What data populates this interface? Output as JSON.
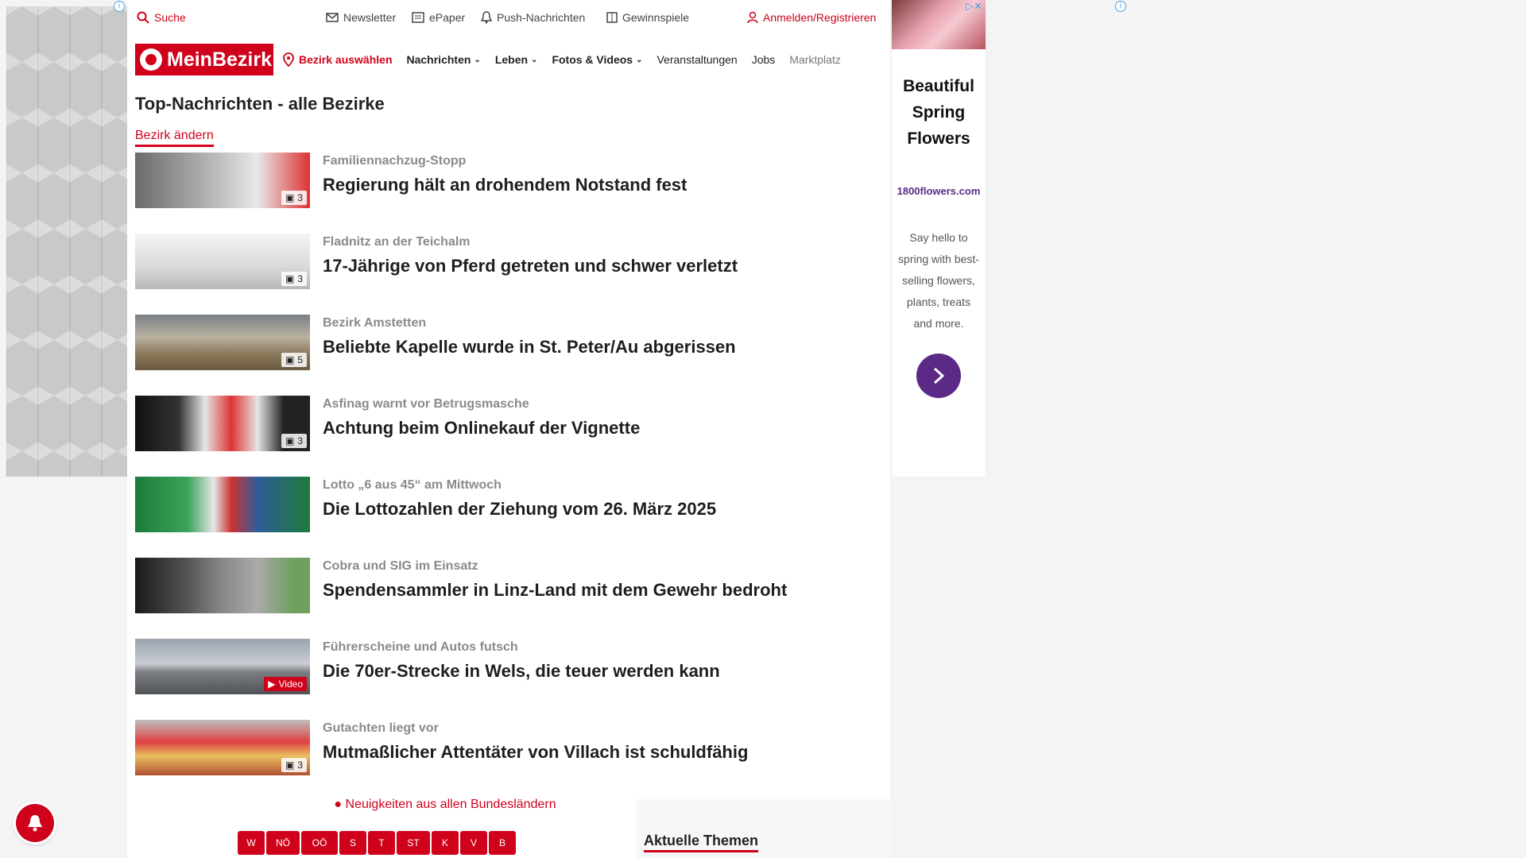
{
  "topbar": {
    "search": "Suche",
    "newsletter": "Newsletter",
    "epaper": "ePaper",
    "push": "Push-Nachrichten",
    "gewinnspiele": "Gewinnspiele",
    "login": "Anmelden/Registrieren"
  },
  "nav": {
    "logo": "MeinBezirk",
    "bezirk": "Bezirk auswählen",
    "items": [
      "Nachrichten",
      "Leben",
      "Fotos & Videos",
      "Veranstaltungen",
      "Jobs",
      "Marktplatz"
    ]
  },
  "page": {
    "title": "Top-Nachrichten - alle Bezirke",
    "change_bezirk": "Bezirk ändern"
  },
  "articles": [
    {
      "kicker": "Familiennachzug-Stopp",
      "headline": "Regierung hält an drohendem Notstand fest",
      "badge": "3"
    },
    {
      "kicker": "Fladnitz an der Teichalm",
      "headline": "17-Jährige von Pferd getreten und schwer verletzt",
      "badge": "3"
    },
    {
      "kicker": "Bezirk Amstetten",
      "headline": "Beliebte Kapelle wurde in St. Peter/Au abgerissen",
      "badge": "5"
    },
    {
      "kicker": "Asfinag warnt vor Betrugsmasche",
      "headline": "Achtung beim Onlinekauf der Vignette",
      "badge": "3"
    },
    {
      "kicker": "Lotto „6 aus 45“ am Mittwoch",
      "headline": "Die Lottozahlen der Ziehung vom 26. März 2025",
      "badge": ""
    },
    {
      "kicker": "Cobra und SIG im Einsatz",
      "headline": "Spendensammler in Linz-Land mit dem Gewehr bedroht",
      "badge": ""
    },
    {
      "kicker": "Führerscheine und Autos futsch",
      "headline": "Die 70er-Strecke in Wels, die teuer werden kann",
      "badge": "Video"
    },
    {
      "kicker": "Gutachten liegt vor",
      "headline": "Mutmaßlicher Attentäter von Villach ist schuldfähig",
      "badge": "3"
    }
  ],
  "footer": {
    "bundeslaender": "Neuigkeiten aus allen Bundesländern",
    "states": [
      "W",
      "NÖ",
      "OÖ",
      "S",
      "T",
      "ST",
      "K",
      "V",
      "B"
    ],
    "topics_title": "Aktuelle Themen"
  },
  "ad": {
    "title": "Beautiful Spring Flowers",
    "brand": "1800flowers.com",
    "body": "Say hello to spring with best-selling flowers, plants, treats and more."
  }
}
